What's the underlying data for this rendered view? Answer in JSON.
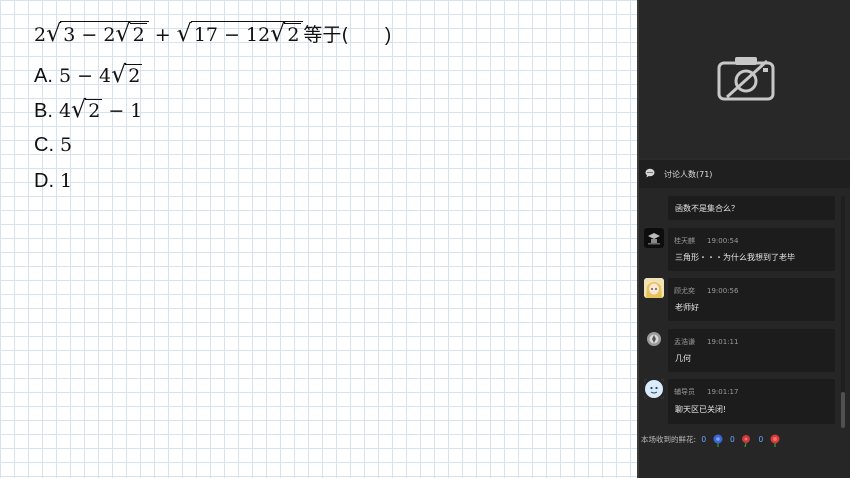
{
  "question": {
    "prefix_coef": "2",
    "radical1_inner_a": "3 − 2",
    "radical1_inner_sqrt": "2",
    "plus": "+",
    "radical2_inner_a": "17 − 12",
    "radical2_inner_sqrt": "2",
    "suffix": "等于(",
    "close": ")"
  },
  "options": [
    {
      "letter": "A.",
      "pre": "5 − 4",
      "sqrt": "2",
      "post": ""
    },
    {
      "letter": "B.",
      "pre": "4",
      "sqrt": "2",
      "post": " − 1"
    },
    {
      "letter": "C.",
      "pre": "5",
      "sqrt": "",
      "post": ""
    },
    {
      "letter": "D.",
      "pre": "1",
      "sqrt": "",
      "post": ""
    }
  ],
  "chat": {
    "header": "讨论人数(71)",
    "messages": [
      {
        "user": "",
        "time": "",
        "text": "函数不是集合么？",
        "avatar": "none"
      },
      {
        "user": "桂天麒",
        "time": "19:00:54",
        "text": "三角形・・・为什么我想到了老毕",
        "avatar": "dark-emblem"
      },
      {
        "user": "顾尤奕",
        "time": "19:00:56",
        "text": "老师好",
        "avatar": "anime-girl"
      },
      {
        "user": "孟浩谦",
        "time": "19:01:11",
        "text": "几何",
        "avatar": "emblem-gray"
      },
      {
        "user": "辅导员",
        "time": "19:01:17",
        "text": "聊天区已关闭!",
        "avatar": "cartoon-face"
      }
    ],
    "flowers": {
      "label": "本场收到的鲜花:",
      "counts": [
        "0",
        "0",
        "0"
      ],
      "colors": [
        "#3a66d6",
        "#c83a3a",
        "#d63a3a"
      ]
    }
  },
  "camera": {
    "icon": "camera-off-icon"
  }
}
